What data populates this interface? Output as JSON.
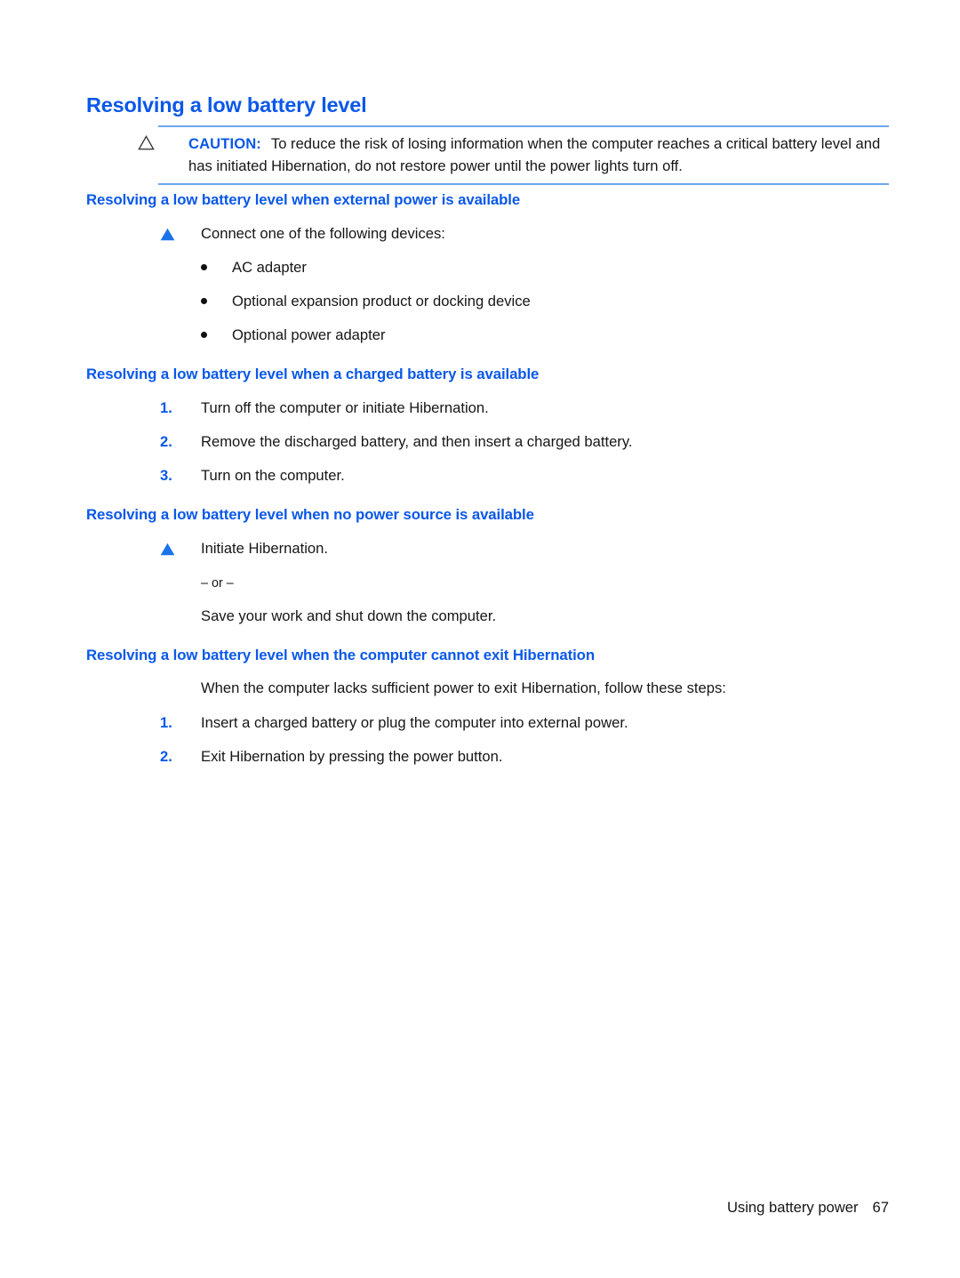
{
  "colors": {
    "heading_blue": "#0a58e8",
    "rule_blue": "#6ea8ee",
    "body_black": "#161616",
    "bullet_black": "#111111",
    "page_background": "#ffffff"
  },
  "page": {
    "title": "Resolving a low battery level"
  },
  "caution": {
    "icon": "caution-triangle-icon",
    "label": "CAUTION:",
    "text": "To reduce the risk of losing information when the computer reaches a critical battery level and has initiated Hibernation, do not restore power until the power lights turn off."
  },
  "sections": [
    {
      "id": "external-power",
      "heading": "Resolving a low battery level when external power is available",
      "lead": {
        "marker": "blue-triangle-bullet-icon",
        "text": "Connect one of the following devices:"
      },
      "bullets": [
        "AC adapter",
        "Optional expansion product or docking device",
        "Optional power adapter"
      ]
    },
    {
      "id": "charged-battery",
      "heading": "Resolving a low battery level when a charged battery is available",
      "steps": [
        {
          "number": "1.",
          "text": "Turn off the computer or initiate Hibernation."
        },
        {
          "number": "2.",
          "text": "Remove the discharged battery, and then insert a charged battery."
        },
        {
          "number": "3.",
          "text": "Turn on the computer."
        }
      ]
    },
    {
      "id": "no-power-source",
      "heading": "Resolving a low battery level when no power source is available",
      "lead": {
        "marker": "blue-triangle-bullet-icon",
        "text": "Initiate Hibernation."
      },
      "or_separator": "– or –",
      "alternative": "Save your work and shut down the computer."
    },
    {
      "id": "cannot-exit-hibernation",
      "heading": "Resolving a low battery level when the computer cannot exit Hibernation",
      "intro": "When the computer lacks sufficient power to exit Hibernation, follow these steps:",
      "steps": [
        {
          "number": "1.",
          "text": "Insert a charged battery or plug the computer into external power."
        },
        {
          "number": "2.",
          "text": "Exit Hibernation by pressing the power button."
        }
      ]
    }
  ],
  "footer": {
    "chapter": "Using battery power",
    "page_number": "67"
  }
}
